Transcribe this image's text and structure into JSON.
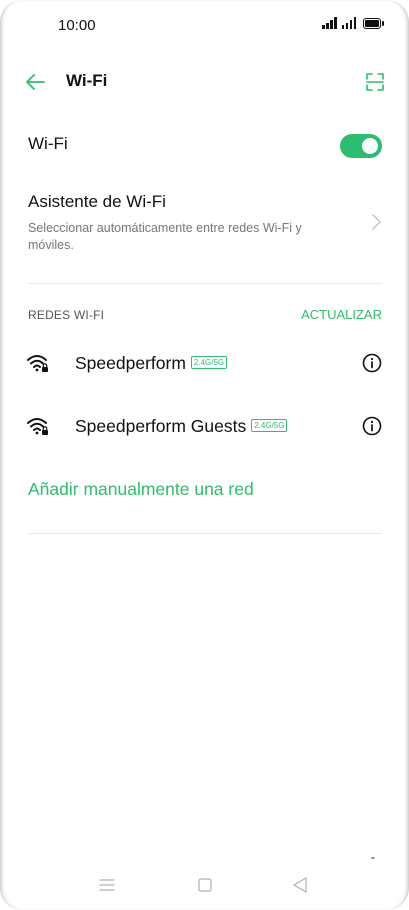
{
  "status_bar": {
    "time": "10:00",
    "icons": [
      "signal-icon",
      "signal-icon",
      "battery-icon"
    ]
  },
  "header": {
    "title": "Wi-Fi",
    "back_icon": "arrow-left-icon",
    "scan_icon": "qr-scan-icon"
  },
  "wifi_toggle": {
    "label": "Wi-Fi",
    "enabled": true
  },
  "assistant": {
    "title": "Asistente de Wi-Fi",
    "description": "Seleccionar automáticamente entre redes Wi-Fi y móviles."
  },
  "networks_section": {
    "title": "REDES WI-FI",
    "refresh_label": "ACTUALIZAR",
    "networks": [
      {
        "name": "Speedperform",
        "band": "2.4G/5G",
        "secured": true
      },
      {
        "name": "Speedperform Guests",
        "band": "2.4G/5G",
        "secured": true
      }
    ],
    "add_manual_label": "Añadir manualmente una red"
  },
  "colors": {
    "accent": "#2dbd6e",
    "text_primary": "#111111",
    "text_secondary": "#777777",
    "divider": "#e8e8e8"
  }
}
